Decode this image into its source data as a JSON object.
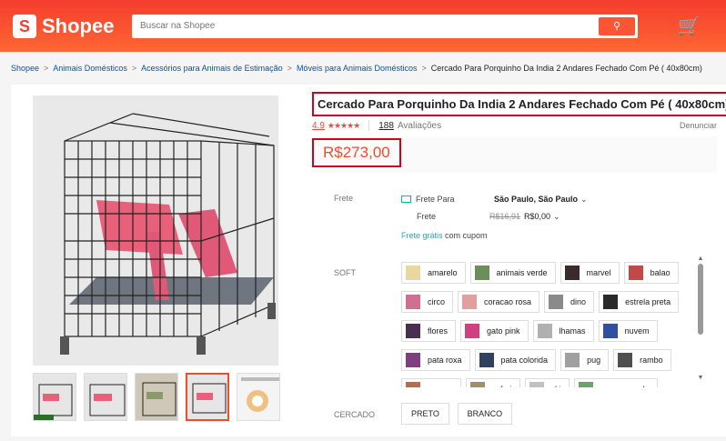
{
  "header": {
    "logo": "Shopee",
    "search_placeholder": "Buscar na Shopee"
  },
  "breadcrumb": [
    "Shopee",
    "Animais Domésticos",
    "Acessórios para Animais de Estimação",
    "Móveis para Animais Domésticos",
    "Cercado Para Porquinho Da India 2 Andares Fechado Com Pé ( 40x80cm)"
  ],
  "product": {
    "title": "Cercado Para Porquinho Da India 2 Andares Fechado Com Pé ( 40x80cm)",
    "rating": "4.9",
    "reviews_count": "188",
    "reviews_label": "Avaliações",
    "report": "Denunciar",
    "price": "R$273,00"
  },
  "shipping": {
    "label": "Frete",
    "to_label": "Frete Para",
    "destination": "São Paulo, São Paulo",
    "cost_label": "Frete",
    "old_cost": "R$16,91",
    "new_cost": "R$0,00",
    "free_highlight": "Frete grátis",
    "free_suffix": "com cupom"
  },
  "soft": {
    "label": "SOFT",
    "options": [
      {
        "label": "amarelo",
        "color": "#e8d7a0"
      },
      {
        "label": "animais verde",
        "color": "#6b8e5a"
      },
      {
        "label": "marvel",
        "color": "#3a2a2a"
      },
      {
        "label": "balao",
        "color": "#c04a4a"
      },
      {
        "label": "circo",
        "color": "#d07090"
      },
      {
        "label": "coracao rosa",
        "color": "#e0a0a0"
      },
      {
        "label": "dino",
        "color": "#8a8a8a"
      },
      {
        "label": "estrela preta",
        "color": "#2a2a2a"
      },
      {
        "label": "flores",
        "color": "#4a3050"
      },
      {
        "label": "gato pink",
        "color": "#d04080"
      },
      {
        "label": "lhamas",
        "color": "#b0b0b0"
      },
      {
        "label": "nuvem",
        "color": "#3050a0"
      },
      {
        "label": "pata roxa",
        "color": "#804080"
      },
      {
        "label": "pata colorida",
        "color": "#304060"
      },
      {
        "label": "pug",
        "color": "#a0a0a0"
      },
      {
        "label": "rambo",
        "color": "#505050"
      },
      {
        "label": "raposa",
        "color": "#b07050"
      },
      {
        "label": "safari",
        "color": "#a09070"
      },
      {
        "label": "ski",
        "color": "#c0c0c0"
      },
      {
        "label": "snoopy verde",
        "color": "#70a070"
      }
    ]
  },
  "cercado": {
    "label": "CERCADO",
    "options": [
      "PRETO",
      "BRANCO"
    ]
  },
  "colors": {
    "brand": "#ee4d2d",
    "highlight_box": "#d0021b",
    "link": "#0055aa"
  }
}
